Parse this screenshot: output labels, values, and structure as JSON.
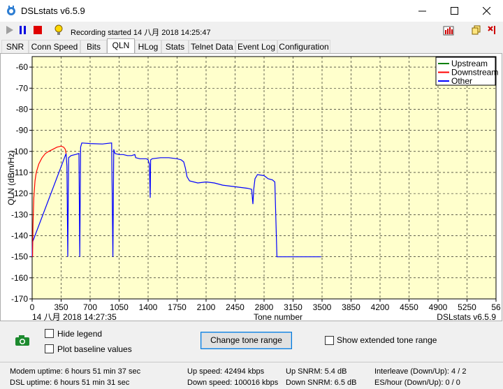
{
  "window": {
    "title": "DSLstats v6.5.9"
  },
  "toolbar": {
    "status": "Recording started 14 八月 2018 14:25:47",
    "icons": [
      "play-icon",
      "pause-icon",
      "stop-icon",
      "bulb-icon",
      "chart-icon",
      "copy-icon",
      "pin-icon"
    ]
  },
  "tabs": [
    "SNR",
    "Conn Speed",
    "Bits",
    "QLN",
    "HLog",
    "Stats",
    "Telnet Data",
    "Event Log",
    "Configuration"
  ],
  "active_tab": "QLN",
  "chart_data": {
    "type": "line",
    "ylabel": "QLN (dBm/Hz)",
    "xlabel": "Tone number",
    "timestamp": "14 八月 2018 14:27:35",
    "watermark": "DSLstats v6.5.9",
    "xlim": [
      0,
      5600
    ],
    "ylim": [
      -170,
      -55
    ],
    "x_ticks": [
      "0",
      "350",
      "700",
      "1050",
      "1400",
      "1750",
      "2100",
      "2450",
      "2800",
      "3150",
      "3500",
      "3850",
      "4200",
      "4550",
      "4900",
      "5250",
      "56"
    ],
    "y_ticks": [
      "-60",
      "-70",
      "-80",
      "-90",
      "-100",
      "-110",
      "-120",
      "-130",
      "-140",
      "-150",
      "-160",
      "-170"
    ],
    "grid": true,
    "legend_position": "top-right",
    "background": "#ffffcc",
    "series": [
      {
        "name": "Upstream",
        "color": "#008000",
        "points": []
      },
      {
        "name": "Downstream",
        "color": "#ff0000",
        "points": [
          [
            5,
            -150
          ],
          [
            10,
            -135
          ],
          [
            20,
            -122
          ],
          [
            35,
            -114
          ],
          [
            50,
            -110
          ],
          [
            80,
            -106
          ],
          [
            120,
            -103
          ],
          [
            160,
            -101
          ],
          [
            200,
            -100
          ],
          [
            250,
            -99
          ],
          [
            300,
            -98
          ],
          [
            350,
            -97.5
          ],
          [
            380,
            -98
          ],
          [
            400,
            -99
          ],
          [
            410,
            -101
          ]
        ]
      },
      {
        "name": "Other",
        "color": "#0000ff",
        "points": [
          [
            0,
            -150
          ],
          [
            5,
            -143
          ],
          [
            410,
            -101
          ],
          [
            420,
            -107
          ],
          [
            430,
            -150
          ],
          [
            440,
            -103
          ],
          [
            470,
            -102
          ],
          [
            520,
            -101.5
          ],
          [
            565,
            -101
          ],
          [
            575,
            -150
          ],
          [
            585,
            -98
          ],
          [
            600,
            -96
          ],
          [
            700,
            -96.3
          ],
          [
            850,
            -96.5
          ],
          [
            960,
            -96
          ],
          [
            975,
            -150
          ],
          [
            985,
            -99
          ],
          [
            1000,
            -101
          ],
          [
            1050,
            -101.5
          ],
          [
            1100,
            -101.5
          ],
          [
            1150,
            -102
          ],
          [
            1200,
            -102
          ],
          [
            1240,
            -101.5
          ],
          [
            1250,
            -103
          ],
          [
            1300,
            -103.5
          ],
          [
            1380,
            -103.5
          ],
          [
            1400,
            -104
          ],
          [
            1415,
            -106
          ],
          [
            1425,
            -122
          ],
          [
            1430,
            -104
          ],
          [
            1450,
            -103.5
          ],
          [
            1550,
            -103
          ],
          [
            1650,
            -103
          ],
          [
            1750,
            -103.5
          ],
          [
            1800,
            -104
          ],
          [
            1830,
            -105
          ],
          [
            1850,
            -108
          ],
          [
            1870,
            -112
          ],
          [
            1900,
            -114
          ],
          [
            2000,
            -115
          ],
          [
            2100,
            -114.5
          ],
          [
            2200,
            -115
          ],
          [
            2300,
            -116
          ],
          [
            2400,
            -116.5
          ],
          [
            2500,
            -117
          ],
          [
            2600,
            -117.5
          ],
          [
            2650,
            -118
          ],
          [
            2665,
            -125
          ],
          [
            2675,
            -118
          ],
          [
            2690,
            -113
          ],
          [
            2720,
            -111
          ],
          [
            2800,
            -111.5
          ],
          [
            2850,
            -113
          ],
          [
            2900,
            -113.5
          ],
          [
            2930,
            -114.5
          ],
          [
            2955,
            -150
          ],
          [
            3000,
            -150
          ],
          [
            3200,
            -150
          ],
          [
            3300,
            -150
          ],
          [
            3400,
            -150
          ],
          [
            3490,
            -150
          ]
        ]
      }
    ]
  },
  "options": {
    "hide_legend": "Hide legend",
    "plot_baseline": "Plot baseline values",
    "change_tone_range": "Change tone range",
    "show_extended": "Show extended tone range"
  },
  "stats": {
    "modem_uptime": "Modem uptime:  6 hours 51 min 37 sec",
    "dsl_uptime": "DSL uptime:  6 hours 51 min 31 sec",
    "up_speed": "Up speed: 42494 kbps",
    "down_speed": "Down speed: 100016 kbps",
    "up_snrm": "Up SNRM: 5.4 dB",
    "down_snrm": "Down SNRM: 6.5 dB",
    "interleave": "Interleave (Down/Up): 4 / 2",
    "es_hour": "ES/hour (Down/Up): 0 / 0"
  }
}
